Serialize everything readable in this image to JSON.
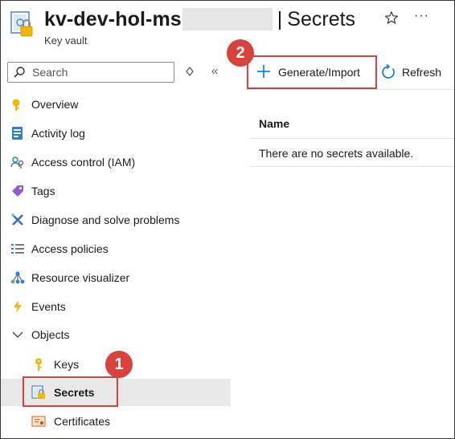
{
  "header": {
    "resource_name": "kv-dev-hol-ms",
    "separator": "|",
    "page_title": "Secrets",
    "subtitle": "Key vault"
  },
  "sidebar": {
    "search_placeholder": "Search",
    "items": [
      {
        "label": "Overview",
        "icon": "overview-icon"
      },
      {
        "label": "Activity log",
        "icon": "activity-log-icon"
      },
      {
        "label": "Access control (IAM)",
        "icon": "iam-icon"
      },
      {
        "label": "Tags",
        "icon": "tag-icon"
      },
      {
        "label": "Diagnose and solve problems",
        "icon": "wrench-icon"
      },
      {
        "label": "Access policies",
        "icon": "list-icon"
      },
      {
        "label": "Resource visualizer",
        "icon": "visualizer-icon"
      },
      {
        "label": "Events",
        "icon": "lightning-icon"
      },
      {
        "label": "Objects",
        "icon": "chevron-down-icon"
      }
    ],
    "objects": [
      {
        "label": "Keys",
        "icon": "key-icon"
      },
      {
        "label": "Secrets",
        "icon": "secret-icon",
        "selected": true
      },
      {
        "label": "Certificates",
        "icon": "certificate-icon"
      }
    ]
  },
  "toolbar": {
    "generate_label": "Generate/Import",
    "refresh_label": "Refresh"
  },
  "table": {
    "column_header": "Name",
    "empty_message": "There are no secrets available."
  },
  "callouts": {
    "step1": "1",
    "step2": "2"
  },
  "colors": {
    "callout": "#d9413d",
    "selected_bg": "#e8e8e8",
    "accent": "#0078d4"
  }
}
